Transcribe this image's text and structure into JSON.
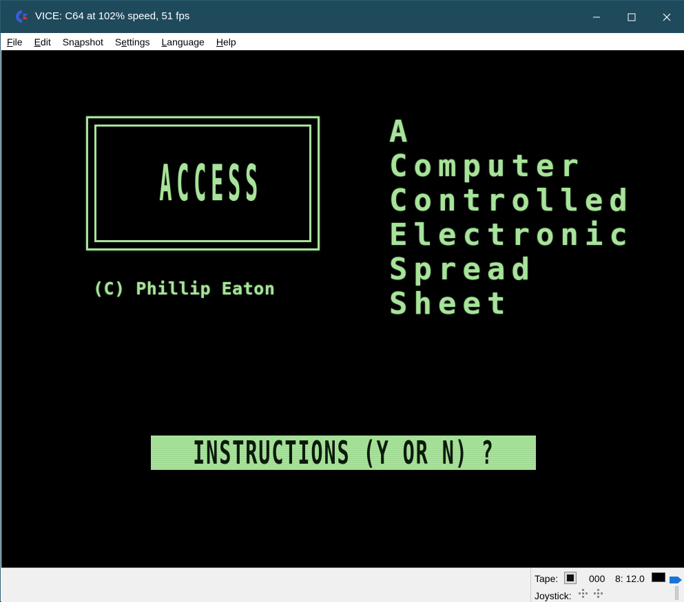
{
  "window": {
    "title": "VICE: C64 at 102% speed, 51 fps",
    "icon": "commodore-logo-icon",
    "buttons": {
      "minimize": "minimize-icon",
      "maximize": "maximize-icon",
      "close": "close-icon"
    }
  },
  "menu": {
    "items": [
      {
        "label_pre": "",
        "label_ul": "F",
        "label_post": "ile"
      },
      {
        "label_pre": "",
        "label_ul": "E",
        "label_post": "dit"
      },
      {
        "label_pre": "Sn",
        "label_ul": "a",
        "label_post": "pshot"
      },
      {
        "label_pre": "S",
        "label_ul": "e",
        "label_post": "ttings"
      },
      {
        "label_pre": "",
        "label_ul": "L",
        "label_post": "anguage"
      },
      {
        "label_pre": "",
        "label_ul": "H",
        "label_post": "elp"
      }
    ]
  },
  "screen": {
    "logo_text": "ACCESS",
    "copyright": "(C) Phillip Eaton",
    "acronym_lines": [
      "A",
      "Computer",
      "Controlled",
      "Electronic",
      "Spread",
      "Sheet"
    ],
    "prompt": "INSTRUCTIONS (Y OR N) ?",
    "colors": {
      "background": "#000000",
      "foreground": "#a7e39a"
    }
  },
  "status": {
    "tape_label": "Tape:",
    "tape_counter": "000",
    "drive": "8: 12.0",
    "joystick_label": "Joystick:"
  }
}
